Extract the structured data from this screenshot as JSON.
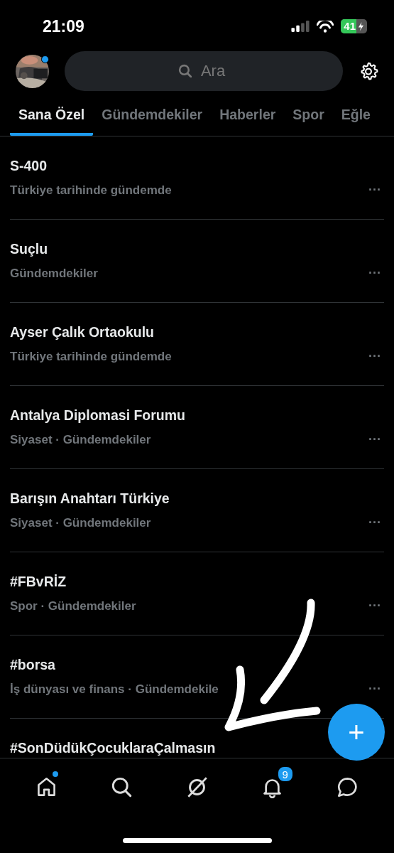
{
  "status_bar": {
    "time": "21:09",
    "battery": "41"
  },
  "header": {
    "search": {
      "placeholder": "Ara"
    },
    "avatar": {
      "kind": "picture",
      "has_new": true
    }
  },
  "tabs": [
    {
      "label": "Sana Özel",
      "selected": true
    },
    {
      "label": "Gündemdekiler",
      "selected": false
    },
    {
      "label": "Haberler",
      "selected": false
    },
    {
      "label": "Spor",
      "selected": false
    },
    {
      "label": "Eğle",
      "selected": false
    }
  ],
  "trends": [
    {
      "title": "S-400",
      "subtitle": "Türkiye tarihinde gündemde",
      "more": "···"
    },
    {
      "title": "Suçlu",
      "subtitle": "Gündemdekiler",
      "more": "···"
    },
    {
      "title": "Ayser Çalık Ortaokulu",
      "subtitle": "Türkiye tarihinde gündemde",
      "more": "···"
    },
    {
      "title": "Antalya Diplomasi Forumu",
      "subtitle": "Siyaset · Gündemdekiler",
      "more": "···"
    },
    {
      "title": "Barışın Anahtarı Türkiye",
      "subtitle": "Siyaset · Gündemdekiler",
      "more": "···"
    },
    {
      "title": "#FBvRİZ",
      "subtitle": "Spor · Gündemdekiler",
      "more": "···"
    },
    {
      "title": "#borsa",
      "subtitle": "İş dünyası ve finans · Gündemdekile",
      "more": "···"
    },
    {
      "title": "#SonDüdükÇocuklaraÇalmasın"
    }
  ],
  "compose_button": {
    "label": "+"
  },
  "bottom_nav": [
    {
      "kind": "home",
      "has_new": true
    },
    {
      "kind": "search"
    },
    {
      "kind": "slashed-circle"
    },
    {
      "kind": "bell",
      "badge": "9"
    },
    {
      "kind": "chat"
    }
  ]
}
